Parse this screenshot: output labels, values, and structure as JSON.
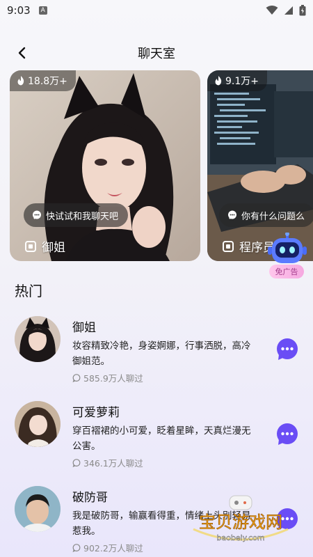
{
  "status_bar": {
    "time": "9:03",
    "notif_letter": "A"
  },
  "header": {
    "title": "聊天室"
  },
  "carousel": [
    {
      "heat": "18.8万+",
      "bubble": "快试试和我聊天吧",
      "name": "御姐"
    },
    {
      "heat": "9.1万+",
      "bubble": "你有什么问题么",
      "name": "程序员"
    }
  ],
  "robot": {
    "tag": "免广告"
  },
  "section": {
    "title": "热门"
  },
  "items": [
    {
      "name": "御姐",
      "desc": "妆容精致冷艳，身姿婀娜，行事洒脱，高冷御姐范。",
      "count": "585.9万人聊过"
    },
    {
      "name": "可爱萝莉",
      "desc": "穿百褶裙的小可爱，眨着星眸，天真烂漫无公害。",
      "count": "346.1万人聊过"
    },
    {
      "name": "破防哥",
      "desc": "我是破防哥，输赢看得重，情绪上头别轻易惹我。",
      "count": "902.2万人聊过"
    }
  ],
  "watermark": {
    "text": "宝贝游戏网",
    "url": "baobeiy.com"
  },
  "colors": {
    "accent": "#6a4df5",
    "badge_bg": "#ffc7ec"
  }
}
